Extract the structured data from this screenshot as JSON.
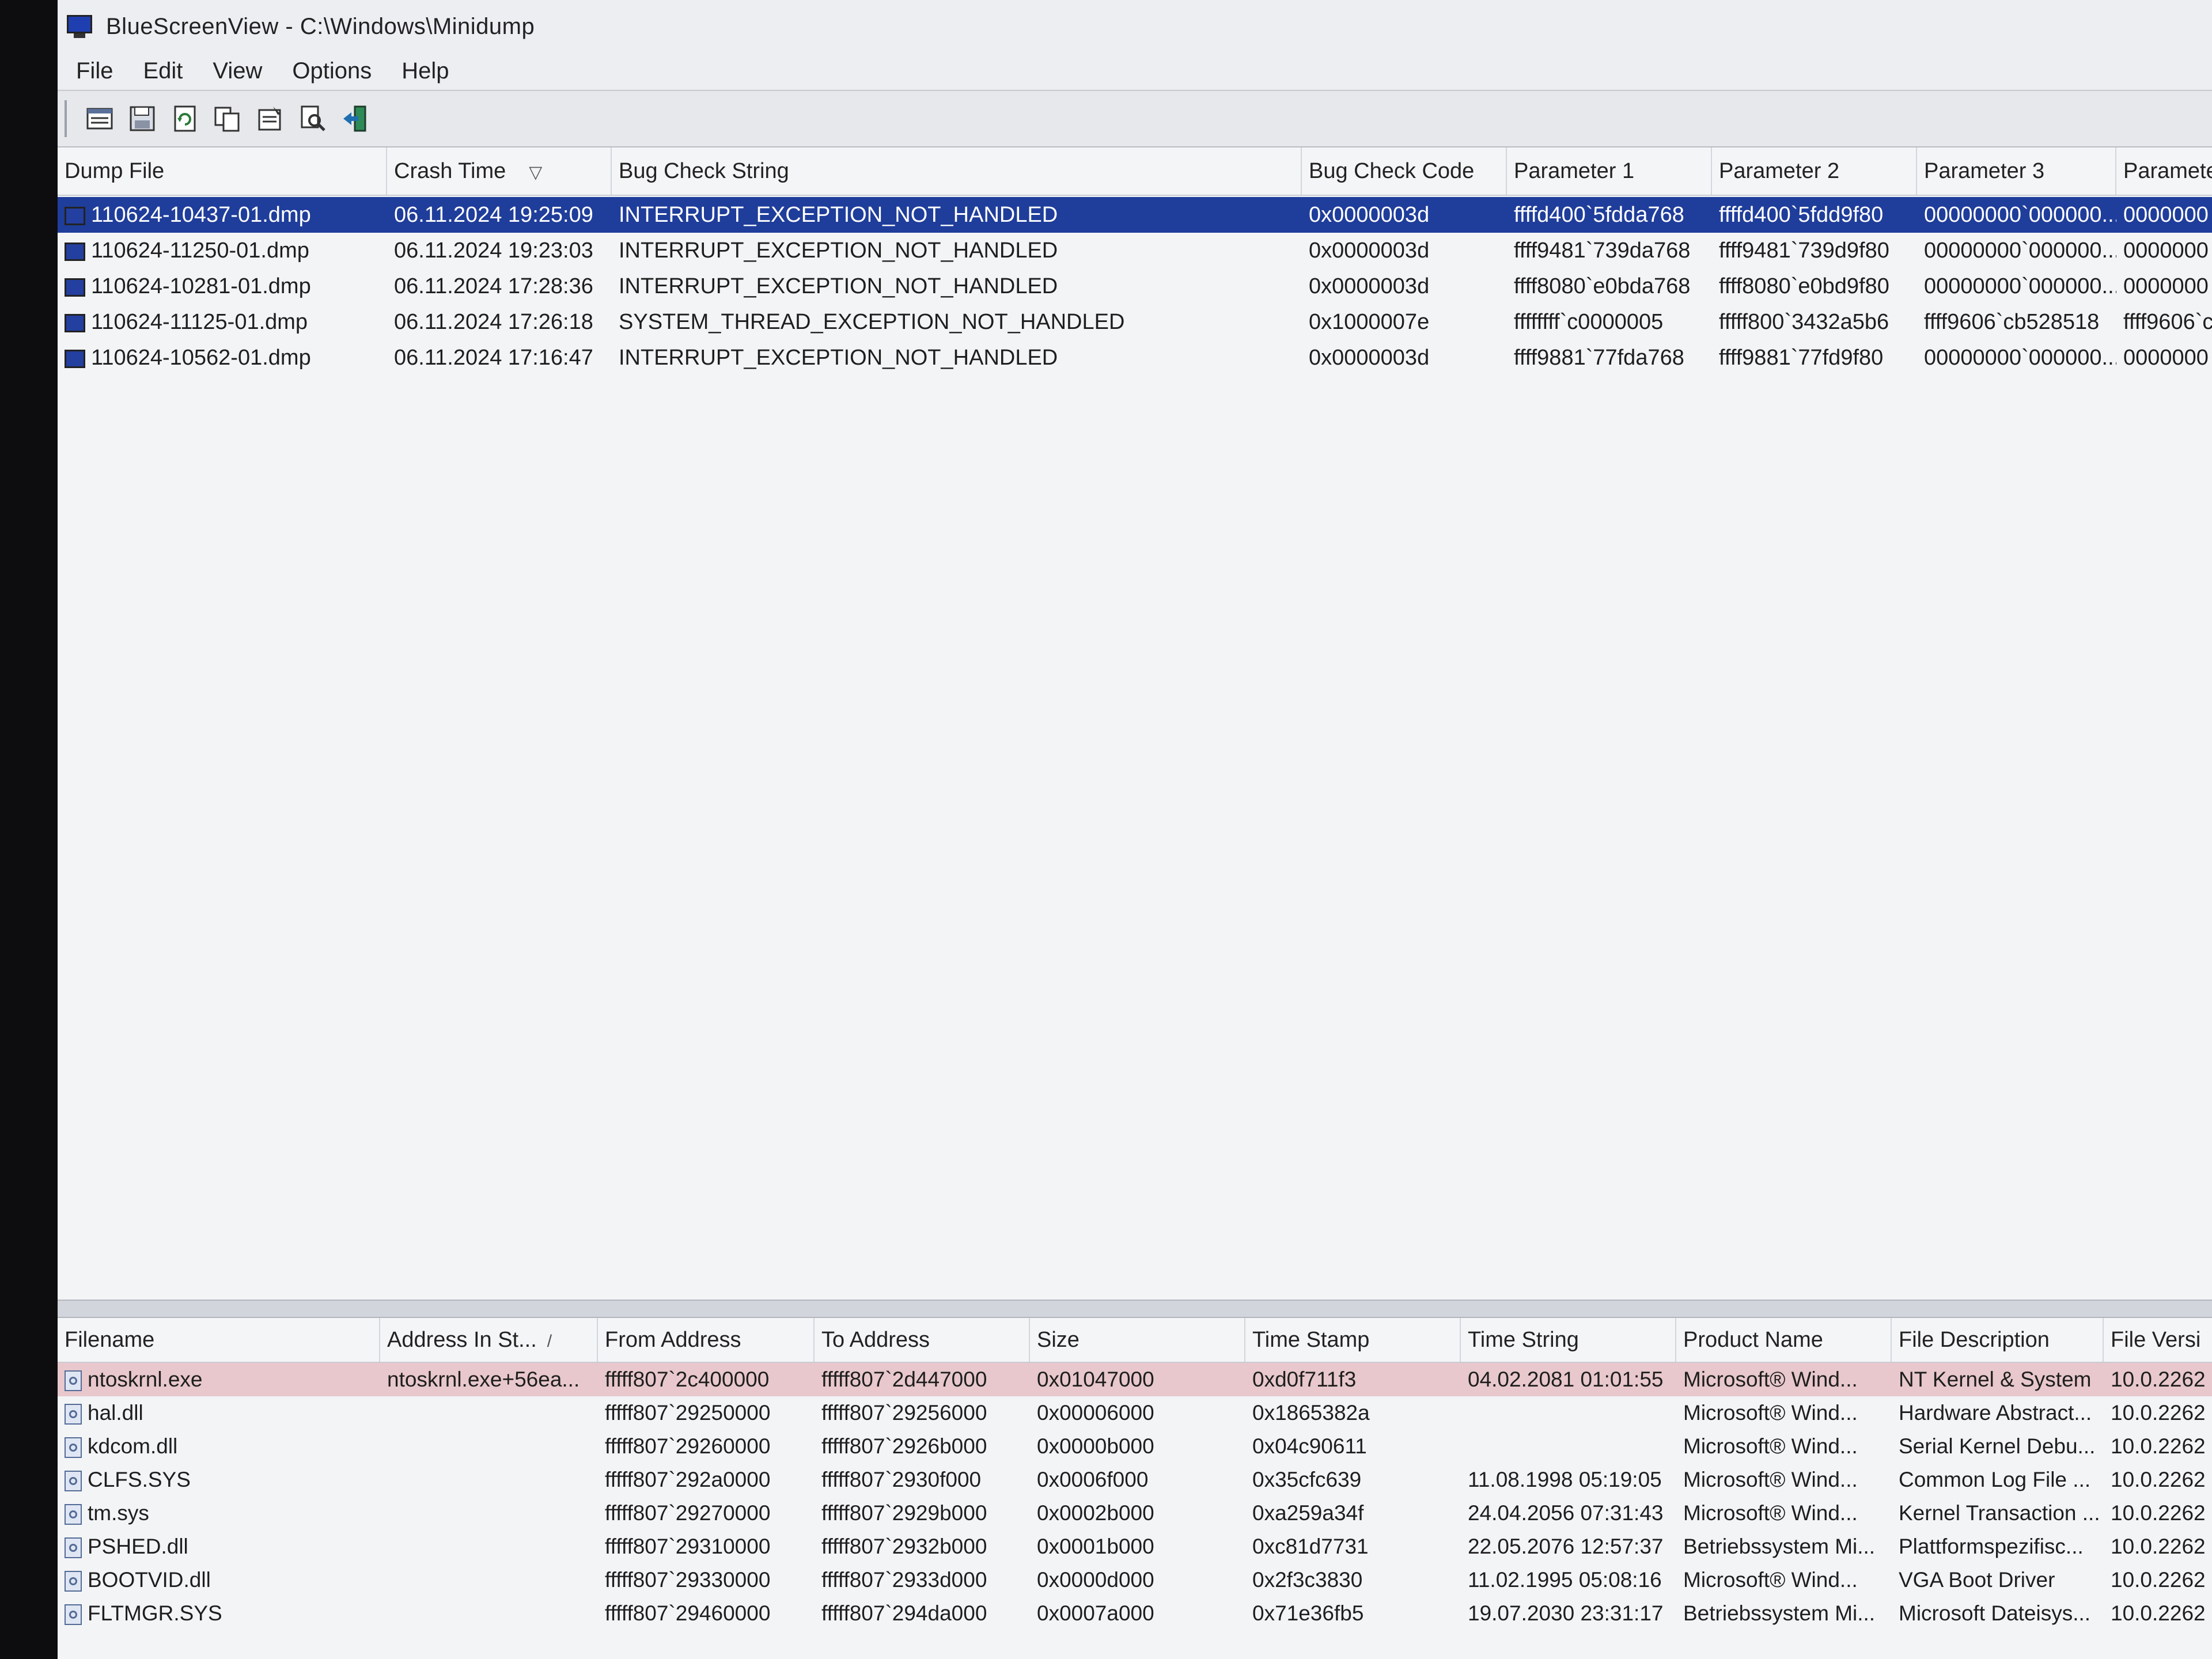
{
  "window": {
    "title": "BlueScreenView  -  C:\\Windows\\Minidump"
  },
  "menu": [
    "File",
    "Edit",
    "View",
    "Options",
    "Help"
  ],
  "toolbar": [
    "html-report-icon",
    "save-icon",
    "refresh-icon",
    "copy-icon",
    "properties-icon",
    "find-icon",
    "exit-icon"
  ],
  "crash_list": {
    "columns": [
      "Dump File",
      "Crash Time",
      "Bug Check String",
      "Bug Check Code",
      "Parameter 1",
      "Parameter 2",
      "Parameter 3",
      "Paramete"
    ],
    "rows": [
      [
        "110624-10437-01.dmp",
        "06.11.2024 19:25:09",
        "INTERRUPT_EXCEPTION_NOT_HANDLED",
        "0x0000003d",
        "ffffd400`5fdda768",
        "ffffd400`5fdd9f80",
        "00000000`000000...",
        "0000000"
      ],
      [
        "110624-11250-01.dmp",
        "06.11.2024 19:23:03",
        "INTERRUPT_EXCEPTION_NOT_HANDLED",
        "0x0000003d",
        "ffff9481`739da768",
        "ffff9481`739d9f80",
        "00000000`000000...",
        "0000000"
      ],
      [
        "110624-10281-01.dmp",
        "06.11.2024 17:28:36",
        "INTERRUPT_EXCEPTION_NOT_HANDLED",
        "0x0000003d",
        "ffff8080`e0bda768",
        "ffff8080`e0bd9f80",
        "00000000`000000...",
        "0000000"
      ],
      [
        "110624-11125-01.dmp",
        "06.11.2024 17:26:18",
        "SYSTEM_THREAD_EXCEPTION_NOT_HANDLED",
        "0x1000007e",
        "ffffffff`c0000005",
        "fffff800`3432a5b6",
        "ffff9606`cb528518",
        "ffff9606`c"
      ],
      [
        "110624-10562-01.dmp",
        "06.11.2024 17:16:47",
        "INTERRUPT_EXCEPTION_NOT_HANDLED",
        "0x0000003d",
        "ffff9881`77fda768",
        "ffff9881`77fd9f80",
        "00000000`000000...",
        "0000000"
      ]
    ]
  },
  "driver_list": {
    "columns": [
      "Filename",
      "Address In St...",
      "From Address",
      "To Address",
      "Size",
      "Time Stamp",
      "Time String",
      "Product Name",
      "File Description",
      "File Versi"
    ],
    "rows": [
      [
        "ntoskrnl.exe",
        "ntoskrnl.exe+56ea...",
        "fffff807`2c400000",
        "fffff807`2d447000",
        "0x01047000",
        "0xd0f711f3",
        "04.02.2081 01:01:55",
        "Microsoft® Wind...",
        "NT Kernel & System",
        "10.0.2262"
      ],
      [
        "hal.dll",
        "",
        "fffff807`29250000",
        "fffff807`29256000",
        "0x00006000",
        "0x1865382a",
        "",
        "Microsoft® Wind...",
        "Hardware Abstract...",
        "10.0.2262"
      ],
      [
        "kdcom.dll",
        "",
        "fffff807`29260000",
        "fffff807`2926b000",
        "0x0000b000",
        "0x04c90611",
        "",
        "Microsoft® Wind...",
        "Serial Kernel Debu...",
        "10.0.2262"
      ],
      [
        "CLFS.SYS",
        "",
        "fffff807`292a0000",
        "fffff807`2930f000",
        "0x0006f000",
        "0x35cfc639",
        "11.08.1998 05:19:05",
        "Microsoft® Wind...",
        "Common Log File ...",
        "10.0.2262"
      ],
      [
        "tm.sys",
        "",
        "fffff807`29270000",
        "fffff807`2929b000",
        "0x0002b000",
        "0xa259a34f",
        "24.04.2056 07:31:43",
        "Microsoft® Wind...",
        "Kernel Transaction ...",
        "10.0.2262"
      ],
      [
        "PSHED.dll",
        "",
        "fffff807`29310000",
        "fffff807`2932b000",
        "0x0001b000",
        "0xc81d7731",
        "22.05.2076 12:57:37",
        "Betriebssystem Mi...",
        "Plattformspezifisc...",
        "10.0.2262"
      ],
      [
        "BOOTVID.dll",
        "",
        "fffff807`29330000",
        "fffff807`2933d000",
        "0x0000d000",
        "0x2f3c3830",
        "11.02.1995 05:08:16",
        "Microsoft® Wind...",
        "VGA Boot Driver",
        "10.0.2262"
      ],
      [
        "FLTMGR.SYS",
        "",
        "fffff807`29460000",
        "fffff807`294da000",
        "0x0007a000",
        "0x71e36fb5",
        "19.07.2030 23:31:17",
        "Betriebssystem Mi...",
        "Microsoft Dateisys...",
        "10.0.2262"
      ]
    ]
  }
}
